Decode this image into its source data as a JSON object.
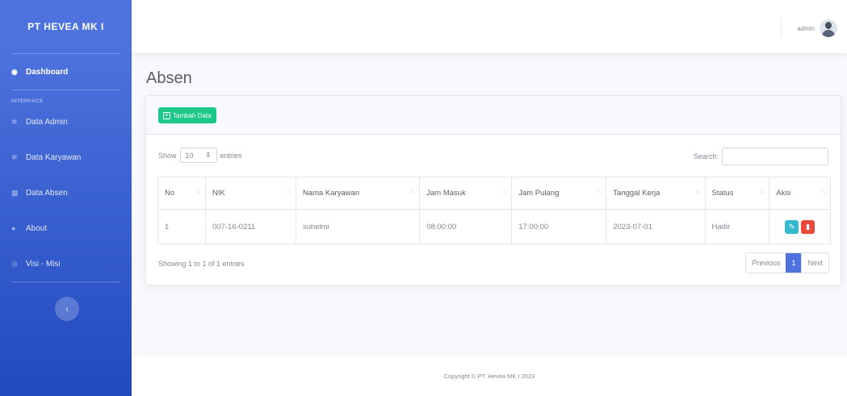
{
  "brand": "PT HEVEA MK I",
  "sidebar": {
    "dashboard": {
      "label": "Dashboard",
      "icon": "tachometer-icon"
    },
    "heading": "INTERFACE",
    "items": [
      {
        "label": "Data Admin",
        "icon": "users-icon"
      },
      {
        "label": "Data Karyawan",
        "icon": "users-icon"
      },
      {
        "label": "Data Absen",
        "icon": "table-icon"
      },
      {
        "label": "About",
        "icon": "info-icon"
      },
      {
        "label": "Visi - Misi",
        "icon": "eye-icon"
      }
    ],
    "toggle_glyph": "‹"
  },
  "topbar": {
    "username": "admin"
  },
  "page": {
    "title": "Absen"
  },
  "card": {
    "add_button": "Tambah Data",
    "show_label": "Show",
    "entries_value": "10",
    "entries_label": "entries",
    "search_label": "Search:",
    "search_value": "",
    "columns": [
      "No",
      "NIK",
      "Nama Karyawan",
      "Jam Masuk",
      "Jam Pulang",
      "Tanggal Kerja",
      "Status",
      "Aksi"
    ],
    "rows": [
      {
        "no": "1",
        "nik": "007-16-0211",
        "nama": "suhelmi",
        "jam_masuk": "08:00:00",
        "jam_pulang": "17:00:00",
        "tanggal": "2023-07-01",
        "status": "Hadir"
      }
    ],
    "info": "Showing 1 to 1 of 1 entries",
    "pagination": {
      "previous": "Previous",
      "current": "1",
      "next": "Next"
    }
  },
  "footer": "Copyright © PT. Hevea MK I 2023",
  "colors": {
    "primary": "#4e73df",
    "success": "#1cc88a",
    "info": "#36b9cc",
    "danger": "#e74a3b"
  }
}
